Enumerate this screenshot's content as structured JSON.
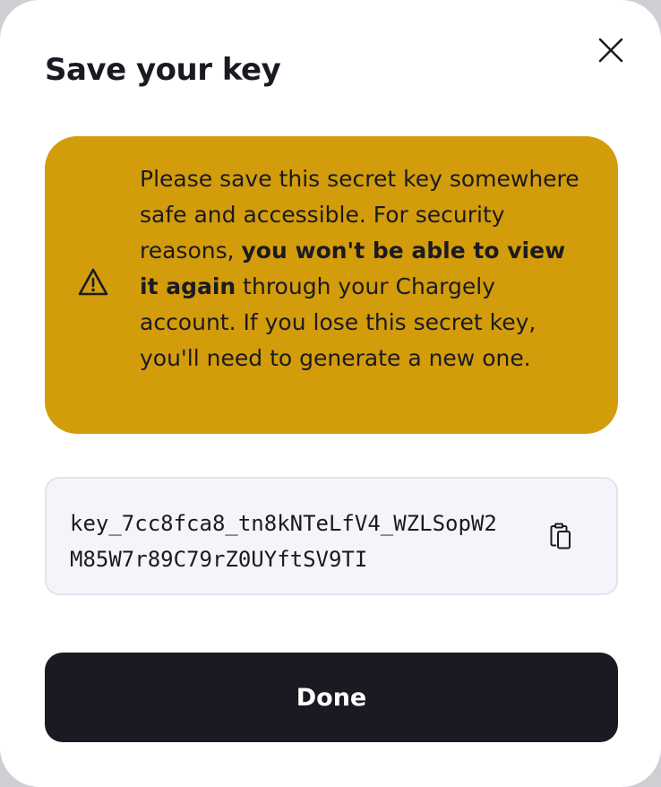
{
  "modal": {
    "title": "Save your key",
    "close_icon": "close-icon"
  },
  "warning": {
    "icon": "warning-triangle-icon",
    "text_part1": "Please save this secret key somewhere safe and accessible. For security reasons, ",
    "text_bold": "you won't be able to view it again",
    "text_part2": " through your Chargely account. If you lose this secret key, you'll need to generate a new one.",
    "background_color": "#d29c0b"
  },
  "key": {
    "value": "key_7cc8fca8_tn8kNTeLfV4_WZLSopW2M85W7r89C79rZ0UYftSV9TI",
    "copy_icon": "clipboard-copy-icon"
  },
  "done_label": "Done",
  "colors": {
    "primary": "#1b1a22",
    "key_background": "#f4f4fa"
  }
}
